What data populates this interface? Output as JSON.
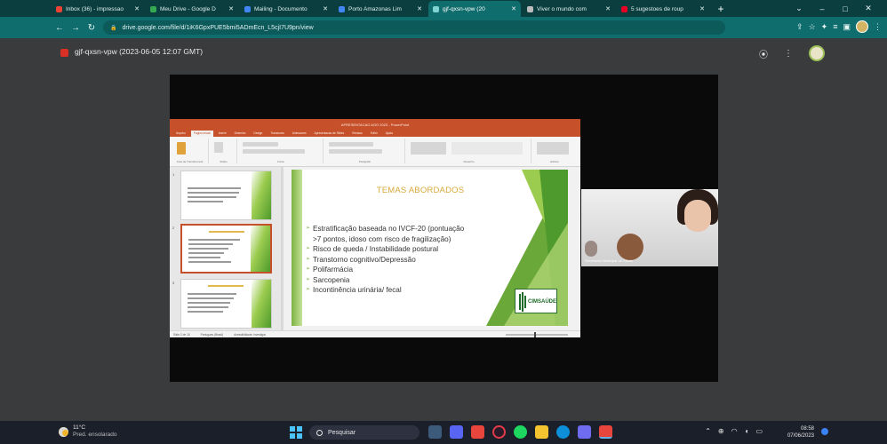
{
  "browser": {
    "tabs": [
      {
        "label": "Inbox (36) - impressao",
        "icon": "gmail-icon",
        "color": "#ea4335",
        "active": false
      },
      {
        "label": "Meu Drive - Google D",
        "icon": "drive-icon",
        "color": "#34a853",
        "active": false
      },
      {
        "label": "Mailing - Documento",
        "icon": "docs-icon",
        "color": "#4285f4",
        "active": false
      },
      {
        "label": "Porto Amazonas Lim",
        "icon": "docs-icon",
        "color": "#4285f4",
        "active": false
      },
      {
        "label": "gjf-qxsn-vpw (20",
        "icon": "drive-video-icon",
        "color": "#0f6d6d",
        "active": true
      },
      {
        "label": "Viver o mundo com",
        "icon": "site-icon",
        "color": "#bdbdbd",
        "active": false
      },
      {
        "label": "5 sugestoes de roup",
        "icon": "pinterest-icon",
        "color": "#e60023",
        "active": false
      }
    ],
    "new_tab": "+",
    "url": "drive.google.com/file/d/1iK6GpxPUE5bmi5ADmEcn_L5cjI7U9pn/view",
    "window_controls": [
      "⌄",
      "–",
      "□",
      "✕"
    ]
  },
  "viewer": {
    "title": "gjf-qxsn-vpw (2023-06-05 12:07 GMT)",
    "actions": [
      "⦿",
      "⋮"
    ]
  },
  "ppt": {
    "title_bar": "APRESENTACAO AGO 2023 - PowerPoint",
    "ribbon_tabs": [
      "Arquivo",
      "Pagina Inicial",
      "Inserir",
      "Desenho",
      "Design",
      "Transicoes",
      "Animacoes",
      "Apresentacao de Slides",
      "Revisao",
      "Exibir",
      "Ajuda"
    ],
    "ribbon_groups": [
      "Area de Transferencia",
      "Slides",
      "Fonte",
      "Paragrafo",
      "Desenho",
      "Edicao"
    ],
    "slide": {
      "title": "TEMAS ABORDADOS",
      "bullets": [
        "Estratificação baseada no IVCF-20 (pontuação",
        ">7 pontos, idoso com risco de fragilização)",
        "Risco de queda / Instabilidade postural",
        "Transtorno cognitivo/Depressão",
        "Polifarmácia",
        "Sarcopenia",
        "Incontinência urinária/ fecal"
      ],
      "logo_text": "CIMSAÚDE"
    },
    "status": [
      "Slide 2 de 15",
      "Portugues (Brasil)",
      "Acessibilidade: investigar"
    ]
  },
  "camera": {
    "label": "Secretaria Municipal de Saude"
  },
  "taskbar": {
    "weather_temp": "11°C",
    "weather_desc": "Pred. ensolarado",
    "search": "Pesquisar",
    "time": "08:58",
    "date": "07/06/2023"
  }
}
